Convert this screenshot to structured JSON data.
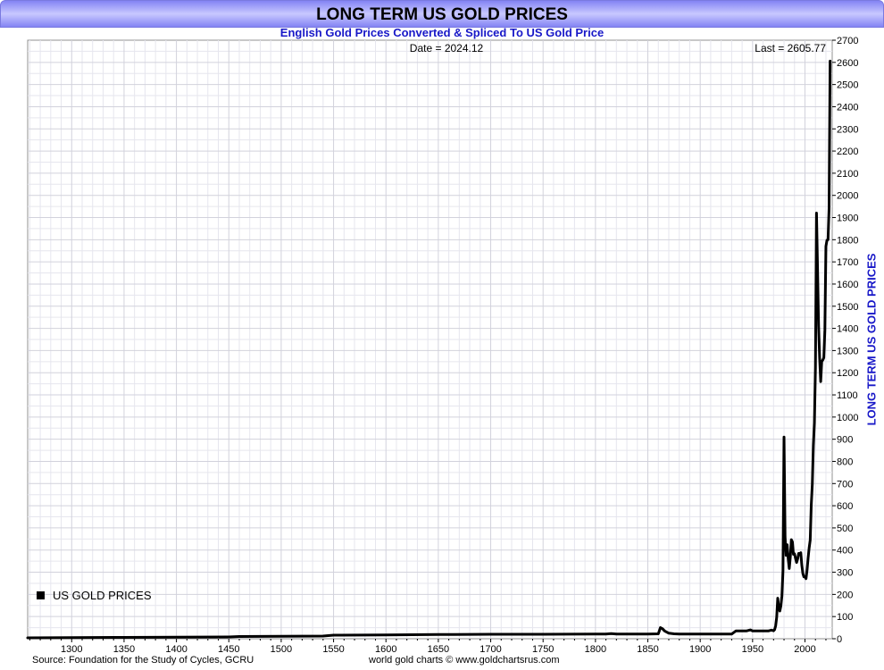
{
  "header": {
    "title": "LONG TERM US GOLD PRICES",
    "subtitle": "English Gold Prices Converted & Spliced To US Gold Price"
  },
  "footer": {
    "source": "Source: Foundation for the Study of Cycles, GCRU",
    "credit": "world gold charts © www.goldchartsrus.com"
  },
  "chart_data": {
    "type": "line",
    "title": "LONG TERM US GOLD PRICES",
    "subtitle": "English Gold Prices Converted & Spliced To US Gold Price",
    "ylabel": "LONG TERM US GOLD PRICES",
    "date_label": "Date = 2024.12",
    "last_label": "Last = 2605.77",
    "legend": {
      "label": "US GOLD PRICES",
      "placement": "bottom-left",
      "color": "#000000"
    },
    "xlim": [
      1258,
      2026
    ],
    "ylim": [
      0,
      2700
    ],
    "x_ticks": [
      1300,
      1350,
      1400,
      1450,
      1500,
      1550,
      1600,
      1650,
      1700,
      1750,
      1800,
      1850,
      1900,
      1950,
      2000
    ],
    "y_ticks": [
      0,
      100,
      200,
      300,
      400,
      500,
      600,
      700,
      800,
      900,
      1000,
      1100,
      1200,
      1300,
      1400,
      1500,
      1600,
      1700,
      1800,
      1900,
      2000,
      2100,
      2200,
      2300,
      2400,
      2500,
      2600,
      2700
    ],
    "grid": true,
    "series": [
      {
        "name": "US GOLD PRICES",
        "color": "#000000",
        "x": [
          1258,
          1300,
          1350,
          1400,
          1450,
          1460,
          1500,
          1540,
          1550,
          1600,
          1650,
          1700,
          1750,
          1800,
          1810,
          1815,
          1820,
          1850,
          1860,
          1862,
          1864,
          1866,
          1868,
          1870,
          1875,
          1880,
          1900,
          1930,
          1934,
          1940,
          1944,
          1948,
          1950,
          1960,
          1965,
          1968,
          1970,
          1971,
          1972,
          1973,
          1974,
          1975,
          1976,
          1977,
          1978,
          1979,
          1980,
          1981,
          1982,
          1983,
          1984,
          1985,
          1986,
          1987,
          1988,
          1989,
          1990,
          1991,
          1992,
          1993,
          1994,
          1995,
          1996,
          1997,
          1998,
          1999,
          2000,
          2001,
          2002,
          2003,
          2004,
          2005,
          2006,
          2007,
          2008,
          2009,
          2010,
          2011,
          2012,
          2013,
          2014,
          2015,
          2016,
          2017,
          2018,
          2019,
          2020,
          2021,
          2022,
          2023,
          2024
        ],
        "y": [
          4,
          5,
          6,
          7,
          8,
          10,
          11,
          12,
          16,
          17,
          19,
          20,
          20,
          21,
          21,
          23,
          21,
          21,
          22,
          50,
          45,
          35,
          30,
          25,
          22,
          21,
          21,
          21,
          35,
          35,
          35,
          40,
          35,
          35,
          35,
          39,
          36,
          41,
          58,
          97,
          183,
          140,
          125,
          148,
          193,
          306,
          910,
          460,
          376,
          424,
          360,
          317,
          368,
          447,
          437,
          381,
          383,
          362,
          344,
          360,
          385,
          384,
          388,
          331,
          294,
          279,
          279,
          271,
          310,
          364,
          410,
          445,
          604,
          696,
          872,
          973,
          1225,
          1920,
          1669,
          1411,
          1266,
          1160,
          1251,
          1257,
          1268,
          1393,
          1770,
          1798,
          1800,
          1940,
          2605.77
        ]
      }
    ]
  }
}
